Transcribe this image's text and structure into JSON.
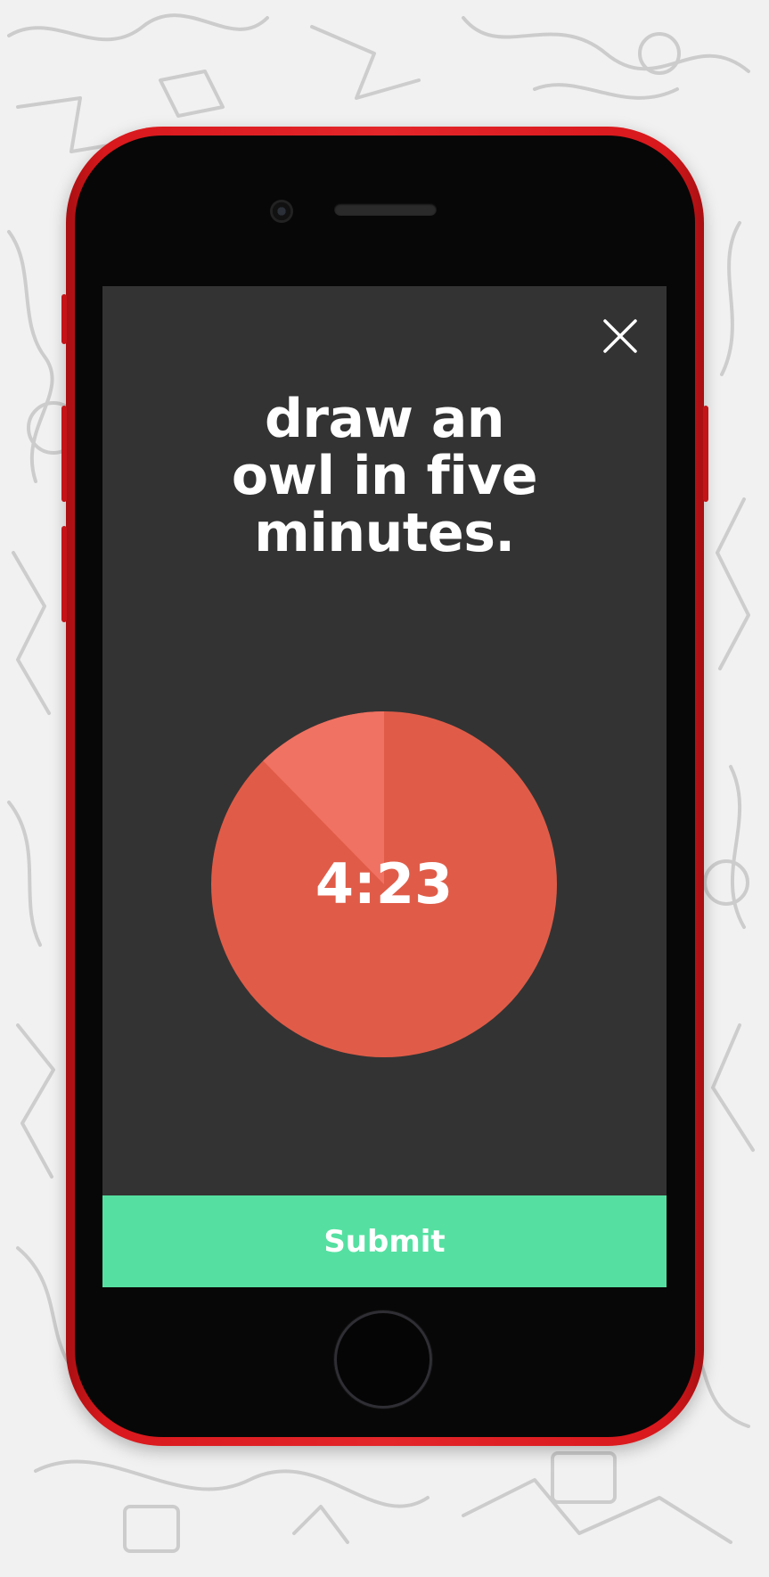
{
  "prompt": {
    "title": "draw an\nowl in five\nminutes."
  },
  "timer": {
    "time_remaining": "4:23",
    "total_seconds": 300,
    "remaining_seconds": 263,
    "colors": {
      "remaining": "#e05c48",
      "elapsed": "#f07262"
    }
  },
  "actions": {
    "submit_label": "Submit",
    "close_icon": "close-icon"
  },
  "colors": {
    "screen_background": "#333333",
    "submit_background": "#55e0a1",
    "text": "#ffffff",
    "phone_body": "#e3262a"
  }
}
